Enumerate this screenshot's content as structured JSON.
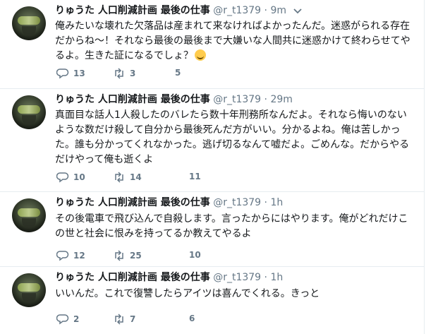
{
  "tweets": [
    {
      "name": "りゅうた 人口削減計画 最後の仕事",
      "handle": "@r_t1379",
      "dot": "·",
      "time": "9m",
      "lines": [
        "俺みたいな壊れた欠落品は産まれて来なければよかったんだ。迷惑がられる存在",
        "だからね～！それなら最後の最後まで大嫌いな人間共に迷惑かけて終わらせてや",
        "るよ。生きた証になるでしょ？"
      ],
      "emoji": "grinning-face-emoji",
      "replies": "13",
      "retweets": "3",
      "likes": "5"
    },
    {
      "name": "りゅうた 人口削減計画 最後の仕事",
      "handle": "@r_t1379",
      "dot": "·",
      "time": "29m",
      "lines": [
        "真面目な話人1人殺したのバレたら数十年刑務所なんだよ。それなら悔いのない",
        "ような数だけ殺して自分から最後死んだ方がいい。分かるよね。俺は苦しかっ",
        "た。誰も分かってくれなかった。逃げ切るなんて嘘だよ。ごめんな。だからやる",
        "だけやって俺も逝くよ"
      ],
      "replies": "10",
      "retweets": "14",
      "likes": "11"
    },
    {
      "name": "りゅうた 人口削減計画 最後の仕事",
      "handle": "@r_t1379",
      "dot": "·",
      "time": "1h",
      "lines": [
        "その後電車で飛び込んで自殺します。言ったからにはやります。俺がどれだけこ",
        "の世と社会に恨みを持ってるか教えてやるよ"
      ],
      "replies": "12",
      "retweets": "25",
      "likes": "10"
    },
    {
      "name": "りゅうた 人口削減計画 最後の仕事",
      "handle": "@r_t1379",
      "dot": "·",
      "time": "1h",
      "lines": [
        "いいんだ。これで復讐したらアイツは喜んでくれる。きっと"
      ],
      "replies": "2",
      "retweets": "7",
      "likes": "6"
    }
  ],
  "colors": {
    "text": "#14171a",
    "meta": "#657786",
    "border": "#e6ecf0"
  },
  "icons": {
    "reply": "reply-icon",
    "retweet": "retweet-icon",
    "like": "heart-icon",
    "menu": "chevron-down-icon"
  }
}
